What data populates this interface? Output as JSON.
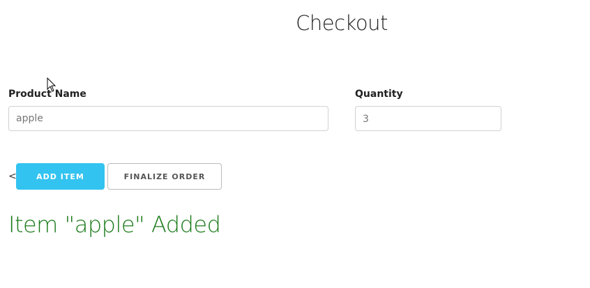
{
  "header": {
    "title": "Checkout"
  },
  "form": {
    "product": {
      "label": "Product Name",
      "value": "apple"
    },
    "quantity": {
      "label": "Quantity",
      "value": "3"
    }
  },
  "actions": {
    "prefix_glyph": "<",
    "add_label": "ADD ITEM",
    "finalize_label": "FINALIZE ORDER"
  },
  "status": {
    "message": "Item \"apple\" Added",
    "color": "#1a7a1a"
  },
  "colors": {
    "accent": "#33c3f0",
    "border": "#d1d1d1"
  },
  "icons": {
    "cursor": "mouse-pointer-icon"
  }
}
